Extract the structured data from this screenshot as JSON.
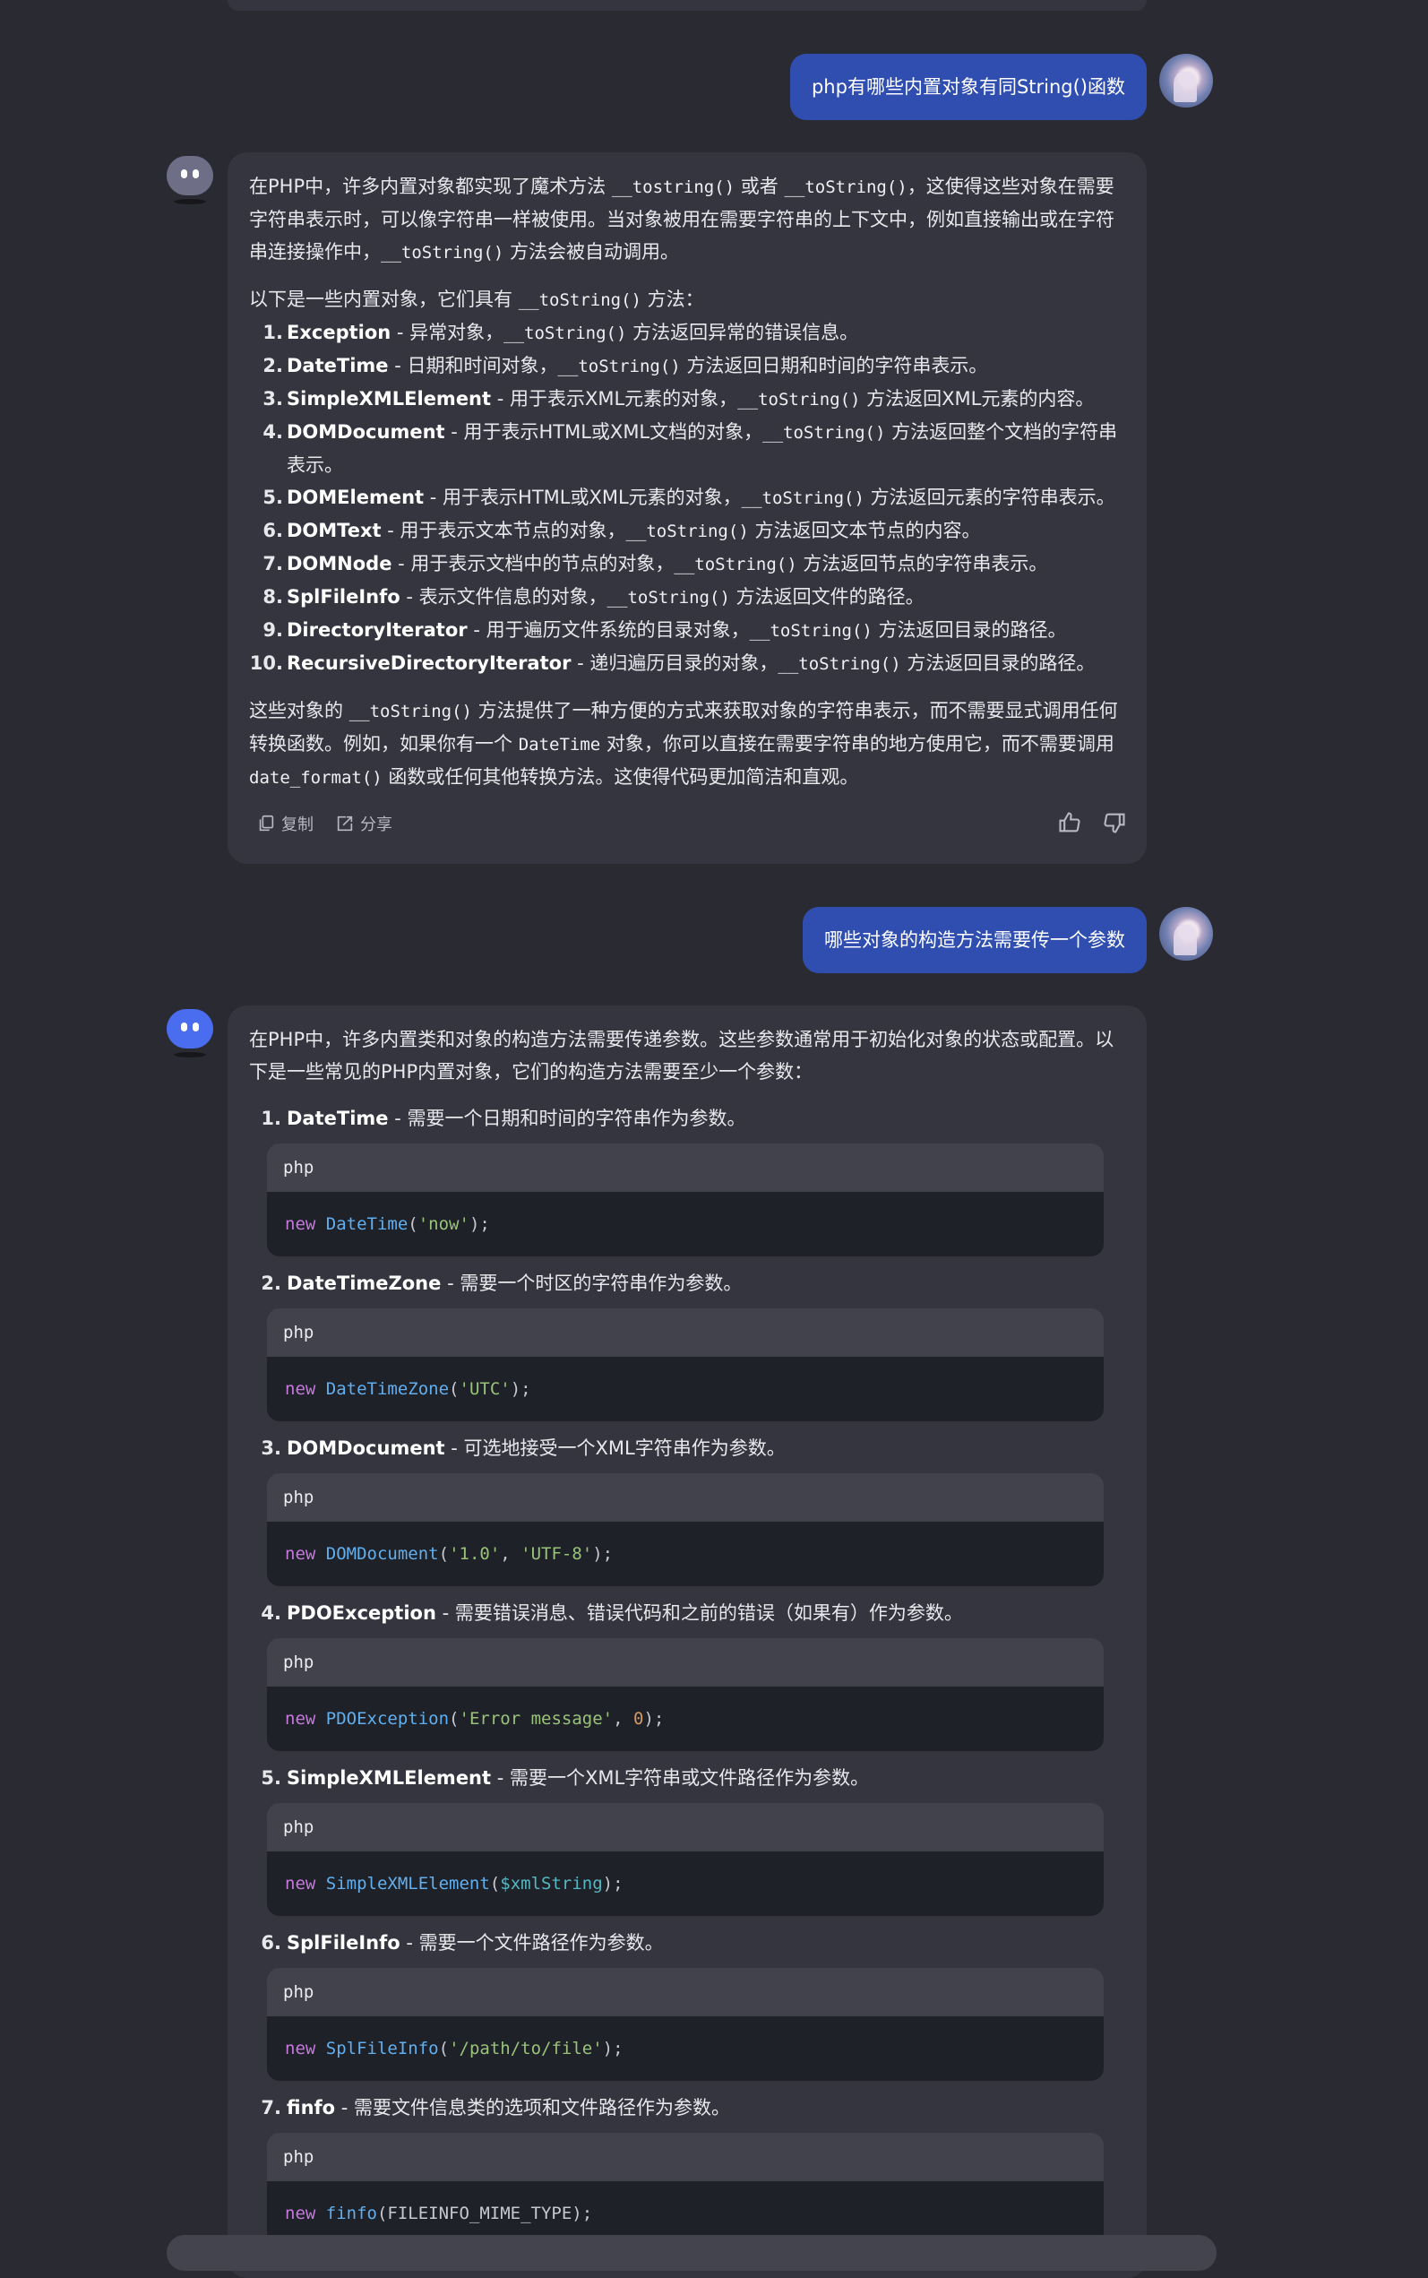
{
  "conversation": {
    "q1": "php有哪些内置对象有同String()函数",
    "a1": {
      "intro_pre": "在PHP中，许多内置对象都实现了魔术方法",
      "intro_c1": "__tostring()",
      "intro_mid": "或者",
      "intro_c2": "__toString()",
      "intro_post": "，这使得这些对象在需要字符串表示时，可以像字符串一样被使用。当对象被用在需要字符串的上下文中，例如直接输出或在字符串连接操作中，",
      "intro_c3": "__toString()",
      "intro_end": "方法会被自动调用。",
      "lead_pre": "以下是一些内置对象，它们具有",
      "lead_code": "__toString()",
      "lead_post": "方法：",
      "items": [
        {
          "num": "1.",
          "name": "Exception",
          "pre": " - 异常对象，",
          "code": "__toString()",
          "post": "方法返回异常的错误信息。"
        },
        {
          "num": "2.",
          "name": "DateTime",
          "pre": " - 日期和时间对象，",
          "code": "__toString()",
          "post": "方法返回日期和时间的字符串表示。"
        },
        {
          "num": "3.",
          "name": "SimpleXMLElement",
          "pre": " - 用于表示XML元素的对象，",
          "code": "__toString()",
          "post": "方法返回XML元素的内容。"
        },
        {
          "num": "4.",
          "name": "DOMDocument",
          "pre": " - 用于表示HTML或XML文档的对象，",
          "code": "__toString()",
          "post": "方法返回整个文档的字符串表示。"
        },
        {
          "num": "5.",
          "name": "DOMElement",
          "pre": " - 用于表示HTML或XML元素的对象，",
          "code": "__toString()",
          "post": "方法返回元素的字符串表示。"
        },
        {
          "num": "6.",
          "name": "DOMText",
          "pre": " - 用于表示文本节点的对象，",
          "code": "__toString()",
          "post": "方法返回文本节点的内容。"
        },
        {
          "num": "7.",
          "name": "DOMNode",
          "pre": " - 用于表示文档中的节点的对象，",
          "code": "__toString()",
          "post": "方法返回节点的字符串表示。"
        },
        {
          "num": "8.",
          "name": "SplFileInfo",
          "pre": " - 表示文件信息的对象，",
          "code": "__toString()",
          "post": "方法返回文件的路径。"
        },
        {
          "num": "9.",
          "name": "DirectoryIterator",
          "pre": " - 用于遍历文件系统的目录对象，",
          "code": "__toString()",
          "post": "方法返回目录的路径。"
        },
        {
          "num": "10.",
          "name": "RecursiveDirectoryIterator",
          "pre": " - 递归遍历目录的对象，",
          "code": "__toString()",
          "post": "方法返回目录的路径。"
        }
      ],
      "outro_pre": "这些对象的",
      "outro_c1": "__toString()",
      "outro_mid1": "方法提供了一种方便的方式来获取对象的字符串表示，而不需要显式调用任何转换函数。例如，如果你有一个",
      "outro_c2": "DateTime",
      "outro_mid2": "对象，你可以直接在需要字符串的地方使用它，而不需要调用",
      "outro_c3": "date_format()",
      "outro_end": "函数或任何其他转换方法。这使得代码更加简洁和直观。",
      "copy_label": "复制",
      "share_label": "分享"
    },
    "q2": "哪些对象的构造方法需要传一个参数",
    "a2": {
      "intro": "在PHP中，许多内置类和对象的构造方法需要传递参数。这些参数通常用于初始化对象的状态或配置。以下是一些常见的PHP内置对象，它们的构造方法需要至少一个参数：",
      "items": [
        {
          "num": "1.",
          "name": "DateTime",
          "desc": " - 需要一个日期和时间的字符串作为参数。",
          "lang": "php",
          "code": [
            {
              "t": "kw",
              "v": "new "
            },
            {
              "t": "fn",
              "v": "DateTime"
            },
            {
              "t": "p",
              "v": "("
            },
            {
              "t": "str",
              "v": "'now'"
            },
            {
              "t": "p",
              "v": ");"
            }
          ]
        },
        {
          "num": "2.",
          "name": "DateTimeZone",
          "desc": " - 需要一个时区的字符串作为参数。",
          "lang": "php",
          "code": [
            {
              "t": "kw",
              "v": "new "
            },
            {
              "t": "fn",
              "v": "DateTimeZone"
            },
            {
              "t": "p",
              "v": "("
            },
            {
              "t": "str",
              "v": "'UTC'"
            },
            {
              "t": "p",
              "v": ");"
            }
          ]
        },
        {
          "num": "3.",
          "name": "DOMDocument",
          "desc": " - 可选地接受一个XML字符串作为参数。",
          "lang": "php",
          "code": [
            {
              "t": "kw",
              "v": "new "
            },
            {
              "t": "fn",
              "v": "DOMDocument"
            },
            {
              "t": "p",
              "v": "("
            },
            {
              "t": "str",
              "v": "'1.0'"
            },
            {
              "t": "p",
              "v": ", "
            },
            {
              "t": "str",
              "v": "'UTF-8'"
            },
            {
              "t": "p",
              "v": ");"
            }
          ]
        },
        {
          "num": "4.",
          "name": "PDOException",
          "desc": " - 需要错误消息、错误代码和之前的错误（如果有）作为参数。",
          "lang": "php",
          "code": [
            {
              "t": "kw",
              "v": "new "
            },
            {
              "t": "fn",
              "v": "PDOException"
            },
            {
              "t": "p",
              "v": "("
            },
            {
              "t": "str",
              "v": "'Error message'"
            },
            {
              "t": "p",
              "v": ", "
            },
            {
              "t": "numl",
              "v": "0"
            },
            {
              "t": "p",
              "v": ");"
            }
          ]
        },
        {
          "num": "5.",
          "name": "SimpleXMLElement",
          "desc": " - 需要一个XML字符串或文件路径作为参数。",
          "lang": "php",
          "code": [
            {
              "t": "kw",
              "v": "new "
            },
            {
              "t": "fn",
              "v": "SimpleXMLElement"
            },
            {
              "t": "p",
              "v": "("
            },
            {
              "t": "var",
              "v": "$xmlString"
            },
            {
              "t": "p",
              "v": ");"
            }
          ]
        },
        {
          "num": "6.",
          "name": "SplFileInfo",
          "desc": " - 需要一个文件路径作为参数。",
          "lang": "php",
          "code": [
            {
              "t": "kw",
              "v": "new "
            },
            {
              "t": "fn",
              "v": "SplFileInfo"
            },
            {
              "t": "p",
              "v": "("
            },
            {
              "t": "str",
              "v": "'/path/to/file'"
            },
            {
              "t": "p",
              "v": ");"
            }
          ]
        },
        {
          "num": "7.",
          "name": "finfo",
          "desc": " - 需要文件信息类的选项和文件路径作为参数。",
          "lang": "php",
          "code": [
            {
              "t": "kw",
              "v": "new "
            },
            {
              "t": "fn",
              "v": "finfo"
            },
            {
              "t": "p",
              "v": "(FILEINFO_MIME_TYPE);"
            }
          ]
        }
      ]
    }
  },
  "colors": {
    "user_bubble": "#2f4eb0",
    "card": "#35353f",
    "background": "#2a2a32",
    "bot_active": "#4a6df0"
  },
  "icons": {
    "copy": "copy-icon",
    "share": "share-icon",
    "like": "thumbs-up-icon",
    "dislike": "thumbs-down-icon"
  }
}
